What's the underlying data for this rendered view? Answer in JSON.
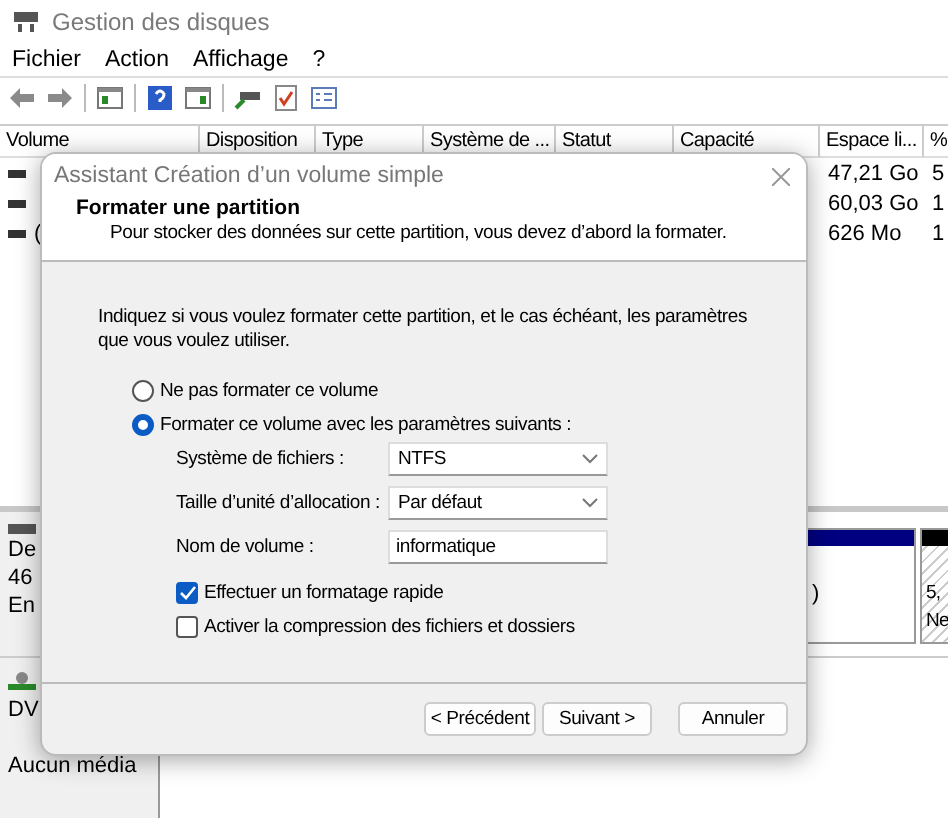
{
  "window": {
    "title": "Gestion des disques"
  },
  "menu": [
    "Fichier",
    "Action",
    "Affichage",
    "?"
  ],
  "table": {
    "columns": [
      "Volume",
      "Disposition",
      "Type",
      "Système de ...",
      "Statut",
      "Capacité",
      "Espace li...",
      "%"
    ],
    "rows": [
      {
        "free_space": "47,21 Go",
        "percent": "5"
      },
      {
        "free_space": "60,03 Go",
        "percent": "1"
      },
      {
        "volume": "(",
        "free_space": "626 Mo",
        "percent": "1"
      }
    ]
  },
  "disks": [
    {
      "kind": "disk",
      "lines": [
        "De",
        "46",
        "En"
      ],
      "partitions": [
        {
          "kind": "primary",
          "color": "#000080",
          "lines": [
            ")"
          ]
        },
        {
          "kind": "unallocated",
          "color": "#000000",
          "lines": [
            "5,",
            "Ne"
          ]
        }
      ]
    },
    {
      "kind": "optical",
      "lines": [
        "DV"
      ],
      "status": "Aucun média"
    }
  ],
  "dialog": {
    "title": "Assistant Création d’un volume simple",
    "heading": "Formater une partition",
    "subheading": "Pour stocker des données sur cette partition, vous devez d’abord la formater.",
    "instructions": "Indiquez si vous voulez formater cette partition, et le cas échéant, les paramètres que vous voulez utiliser.",
    "options": [
      {
        "label": "Ne pas formater ce volume",
        "selected": false
      },
      {
        "label": "Formater ce volume avec les paramètres suivants :",
        "selected": true
      }
    ],
    "fields": [
      {
        "kind": "dropdown",
        "label": "Système de fichiers :",
        "value": "NTFS"
      },
      {
        "kind": "dropdown",
        "label": "Taille d’unité d’allocation :",
        "value": "Par défaut"
      },
      {
        "kind": "text",
        "label": "Nom de volume :",
        "value": "informatique"
      }
    ],
    "checkboxes": [
      {
        "label": "Effectuer un formatage rapide",
        "checked": true
      },
      {
        "label": "Activer la compression des fichiers et dossiers",
        "checked": false
      }
    ],
    "buttons": [
      "< Précédent",
      "Suivant >",
      "Annuler"
    ]
  }
}
